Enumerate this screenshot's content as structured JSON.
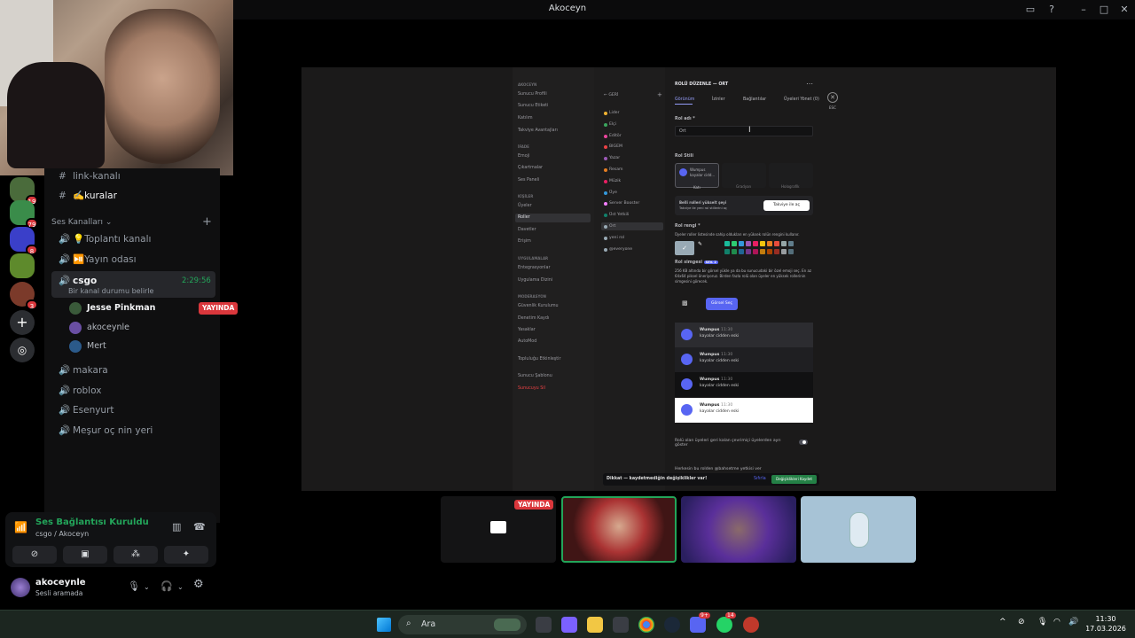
{
  "window": {
    "title": "Akoceyn"
  },
  "servers": {
    "badges": [
      "19",
      "79",
      "8",
      "3"
    ]
  },
  "channels": {
    "text_items": [
      {
        "label": "link-kanalı"
      },
      {
        "label": "✍️kuralar"
      }
    ],
    "voice_header": "Ses Kanalları",
    "voice_items": [
      {
        "label": "💡Toplantı kanalı"
      },
      {
        "label": "⏯️Yayın odası"
      }
    ],
    "active": {
      "label": "csgo",
      "timer": "2:29:56",
      "status": "Bir kanal durumu belirle"
    },
    "voice_users": [
      {
        "name": "Jesse Pinkman",
        "badge": "YAYINDA"
      },
      {
        "name": "akoceynle"
      },
      {
        "name": "Mert"
      }
    ],
    "other_voice": [
      {
        "label": "makara"
      },
      {
        "label": "roblox"
      },
      {
        "label": "Esenyurt"
      },
      {
        "label": "Meşur oç nin yeri"
      }
    ]
  },
  "voice_panel": {
    "status": "Ses Bağlantısı Kuruldu",
    "sub": "csgo / Akoceyn"
  },
  "user": {
    "name": "akoceynle",
    "status": "Sesli aramada"
  },
  "stream": {
    "left_nav": {
      "header1": "AKOCEYN",
      "items1": [
        "Sunucu Profili",
        "Sunucu Etiketi",
        "Katılım",
        "Takviye Avantajları"
      ],
      "header2": "İFADE",
      "items2": [
        "Emoji",
        "Çıkartmalar",
        "Ses Paneli"
      ],
      "header3": "KİŞİLER",
      "items3": [
        "Üyeler",
        "Roller",
        "Davetler",
        "Erişim"
      ],
      "header4": "UYGULAMALAR",
      "items4": [
        "Entegrasyonlar",
        "Uygulama Dizini"
      ],
      "header5": "MODERASYON",
      "items5": [
        "Güvenlik Kurulumu",
        "Denetim Kaydı",
        "Yasaklar",
        "AutoMod"
      ],
      "items6": [
        "Topluluğu Etkinleştir",
        "Sunucu Şablonu"
      ],
      "danger": "Sunucuyu Sil"
    },
    "roles": {
      "back": "GERİ",
      "items": [
        {
          "label": "Lider",
          "color": "#f0b232"
        },
        {
          "label": "Elçi",
          "color": "#3ba55d"
        },
        {
          "label": "Editör",
          "color": "#eb459e"
        },
        {
          "label": "BIGEM",
          "color": "#ed4245"
        },
        {
          "label": "Yazar",
          "color": "#9b59b6"
        },
        {
          "label": "Resam",
          "color": "#e67e22"
        },
        {
          "label": "Müzik",
          "color": "#e91e63"
        },
        {
          "label": "Üye",
          "color": "#3498db"
        },
        {
          "label": "Server Booster",
          "color": "#f47fff"
        },
        {
          "label": "Üst Yetkili",
          "color": "#11806a"
        },
        {
          "label": "Ort",
          "color": "#99aab5"
        },
        {
          "label": "yeni rol",
          "color": "#99aab5"
        },
        {
          "label": "@everyone",
          "color": "#99aab5"
        }
      ]
    },
    "editor": {
      "title": "ROLÜ DÜZENLE — ORT",
      "tabs": [
        "Görünüm",
        "İzinler",
        "Bağlantılar",
        "Üyeleri Yönet (0)"
      ],
      "esc": "ESC",
      "name_label": "Rol adı *",
      "name_value": "Ort",
      "style_label": "Rol Stili",
      "style_card": "Wumpus",
      "style_card_msg": "kayalar cidd...",
      "style_opts": [
        "Katı",
        "Gradyan",
        "Holografik"
      ],
      "boost_text": "Belli rolleri yükselt şeyi",
      "boost_sub": "Takviye ile yeni rol stillerini aç",
      "boost_btn": "Takviye ile aç",
      "color_label": "Rol rengi *",
      "color_help": "Üyeler roller listesinde sahip oldukları en yüksek rolün rengini kullanır.",
      "icon_label": "Rol simgesi",
      "icon_badge": "SEV. 2",
      "icon_help": "256 KB altında bir görsel yükle ya da bu sunucudaki bir özel emoji seç. En az 64x64 piksel öneriyoruz. Birden fazla rolü olan üyeler en yüksek rollerinin simgesini görecek.",
      "icon_btn": "Görsel Seç",
      "preview_name": "Wumpus",
      "preview_time": "11:30",
      "preview_msg": "kayalar cidden eski",
      "toggle1": "Rolü olan üyeleri geri kalan çevrimiçi üyelerden ayrı göster",
      "toggle2": "Herkesin bu rolden @bahsetme yetkisi ver",
      "unsaved": "Dikkat — kaydetmediğin değişiklikler var!",
      "reset": "Sıfırla",
      "save": "Değişiklikleri Kaydet",
      "swatches": [
        "#1abc9c",
        "#2ecc71",
        "#3498db",
        "#9b59b6",
        "#e91e63",
        "#f1c40f",
        "#e67e22",
        "#e74c3c",
        "#95a5a6",
        "#607d8b",
        "#11806a",
        "#1f8b4c",
        "#206694",
        "#71368a",
        "#ad1457",
        "#c27c0e",
        "#a84300",
        "#992d22",
        "#979c9f",
        "#546e7a"
      ]
    }
  },
  "tiles": {
    "live": "YAYINDA"
  },
  "taskbar": {
    "search": "Ara",
    "time": "11:30",
    "date": "17.03.2026",
    "discord_badge": "9+",
    "whatsapp_badge": "14"
  }
}
